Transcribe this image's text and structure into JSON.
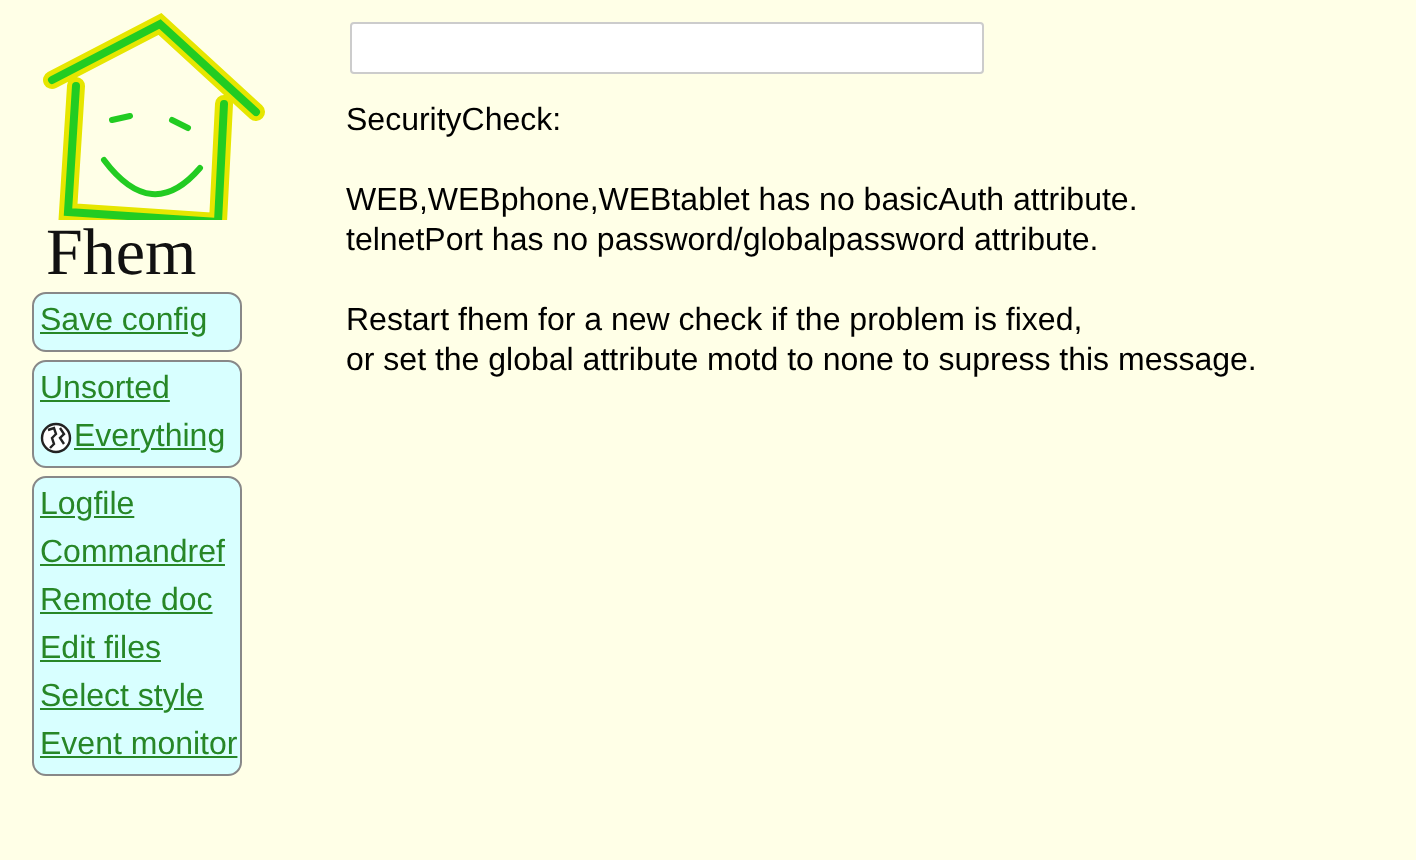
{
  "logo": {
    "text": "Fhem"
  },
  "menu_groups": [
    {
      "items": [
        {
          "label": "Save config",
          "kind": "link"
        }
      ]
    },
    {
      "items": [
        {
          "label": "Unsorted",
          "kind": "link"
        },
        {
          "label": " Everything",
          "kind": "globe"
        }
      ]
    },
    {
      "items": [
        {
          "label": "Logfile",
          "kind": "link"
        },
        {
          "label": "Commandref",
          "kind": "link"
        },
        {
          "label": "Remote doc",
          "kind": "link"
        },
        {
          "label": "Edit files",
          "kind": "link"
        },
        {
          "label": "Select style",
          "kind": "link"
        },
        {
          "label": "Event monitor",
          "kind": "link"
        }
      ]
    }
  ],
  "message": {
    "title": "SecurityCheck:",
    "paragraphs": [
      [
        "WEB,WEBphone,WEBtablet has no basicAuth attribute.",
        "telnetPort has no password/globalpassword attribute."
      ],
      [
        "Restart fhem for a new check if the problem is fixed,",
        "or set the global attribute motd to none to supress this message."
      ]
    ]
  }
}
